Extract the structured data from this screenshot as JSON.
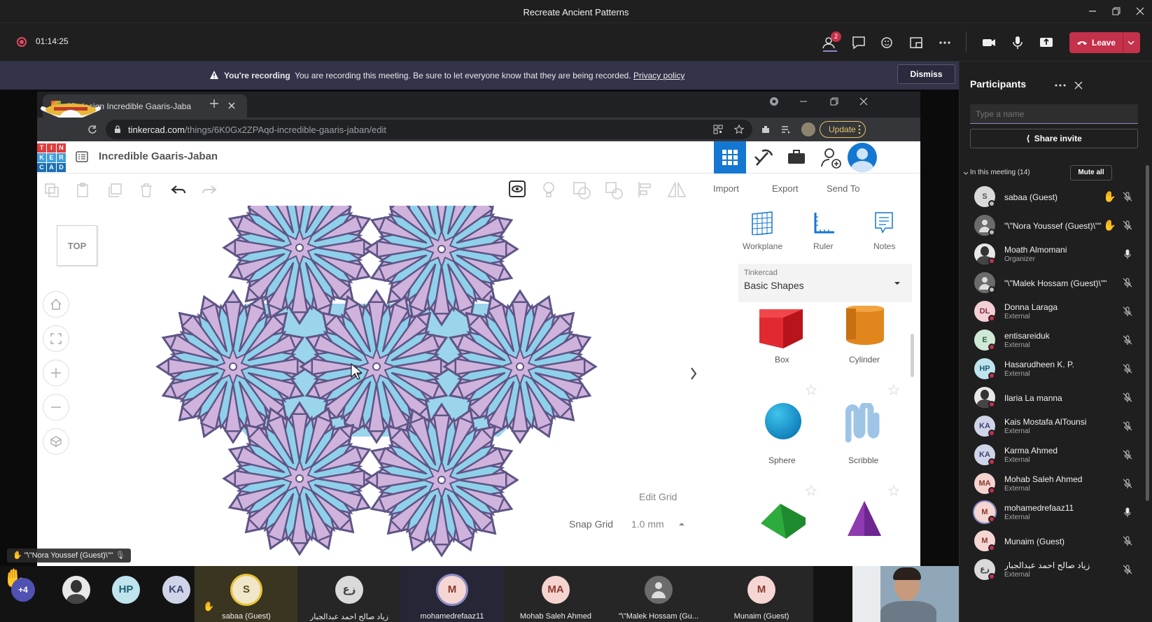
{
  "window": {
    "title": "Recreate Ancient Patterns"
  },
  "meeting": {
    "timer": "01:14:25",
    "participants_badge": "2",
    "leave_label": "Leave"
  },
  "banner": {
    "strong": "You're recording",
    "text": "You are recording this meeting. Be sure to let everyone know that they are being recorded.",
    "link": "Privacy policy",
    "dismiss": "Dismiss"
  },
  "browser": {
    "tab_title": "3D design Incredible Gaaris-Jaba",
    "url_host": "tinkercad.com",
    "url_path": "/things/6K0Gx2ZPAqd-incredible-gaaris-jaban/edit",
    "update_label": "Update"
  },
  "tinkercad": {
    "logo": [
      "T",
      "I",
      "N",
      "K",
      "E",
      "R",
      "C",
      "A",
      "D"
    ],
    "design_title": "Incredible Gaaris-Jaban",
    "actions": {
      "import": "Import",
      "export": "Export",
      "send_to": "Send To"
    },
    "view_cube": "TOP",
    "tools": {
      "workplane": "Workplane",
      "ruler": "Ruler",
      "notes": "Notes"
    },
    "library": {
      "provider": "Tinkercad",
      "category": "Basic Shapes"
    },
    "shapes": [
      {
        "name": "Box"
      },
      {
        "name": "Cylinder"
      },
      {
        "name": "Sphere"
      },
      {
        "name": "Scribble"
      }
    ],
    "edit_grid": "Edit Grid",
    "snap_grid_label": "Snap Grid",
    "snap_grid_value": "1.0 mm"
  },
  "participants": {
    "title": "Participants",
    "search_placeholder": "Type a name",
    "share_invite": "Share invite",
    "section_label": "In this meeting (14)",
    "mute_all": "Mute all",
    "list": [
      {
        "name": "sabaa (Guest)",
        "sub": "",
        "initials": "S",
        "hand": true
      },
      {
        "name": "\"\\\"Nora Youssef (Guest)\\\"\"",
        "sub": "",
        "initials": "",
        "hand": true
      },
      {
        "name": "Moath Almomani",
        "sub": "Organizer",
        "initials": "",
        "hand": false
      },
      {
        "name": "\"\\\"Malek Hossam (Guest)\\\"\"",
        "sub": "",
        "initials": "",
        "hand": false
      },
      {
        "name": "Donna Laraga",
        "sub": "External",
        "initials": "DL",
        "hand": false
      },
      {
        "name": "entisareiduk",
        "sub": "External",
        "initials": "E",
        "hand": false
      },
      {
        "name": "Hasarudheen K. P.",
        "sub": "External",
        "initials": "HP",
        "hand": false
      },
      {
        "name": "Ilaria La manna",
        "sub": "",
        "initials": "",
        "hand": false
      },
      {
        "name": "Kais Mostafa AlTounsi",
        "sub": "External",
        "initials": "KA",
        "hand": false
      },
      {
        "name": "Karma Ahmed",
        "sub": "External",
        "initials": "KA",
        "hand": false
      },
      {
        "name": "Mohab Saleh Ahmed",
        "sub": "External",
        "initials": "MA",
        "hand": false
      },
      {
        "name": "mohamedrefaaz11",
        "sub": "External",
        "initials": "M",
        "hand": false
      },
      {
        "name": "Munaim (Guest)",
        "sub": "",
        "initials": "M",
        "hand": false
      },
      {
        "name": "زياد صالح احمد عبدالجبار",
        "sub": "External",
        "initials": "زع",
        "hand": false
      }
    ]
  },
  "stage": {
    "overlay_name": "\"\\\"Nora Youssef (Guest)\\\"\"",
    "more_count": "+4",
    "mini_avatars": [
      "HP",
      "KA"
    ],
    "tiles": [
      {
        "name": "sabaa (Guest)",
        "initials": "S"
      },
      {
        "name": "زياد صالح احمد عبدالجبار",
        "initials": "زع"
      },
      {
        "name": "mohamedrefaaz11",
        "initials": "M"
      },
      {
        "name": "Mohab Saleh Ahmed",
        "initials": "MA"
      },
      {
        "name": "\"\\\"Malek Hossam (Gu...",
        "initials": ""
      },
      {
        "name": "Munaim (Guest)",
        "initials": "M"
      }
    ]
  },
  "colors": {
    "leave": "#c4314b",
    "banner": "#33344a",
    "panel": "#1f1f1f",
    "tinkercad_blue": "#1477d1",
    "shape_fill": "#cfb3dd",
    "shape_outline": "#5d5585",
    "cutout": "#8fd0ea"
  }
}
